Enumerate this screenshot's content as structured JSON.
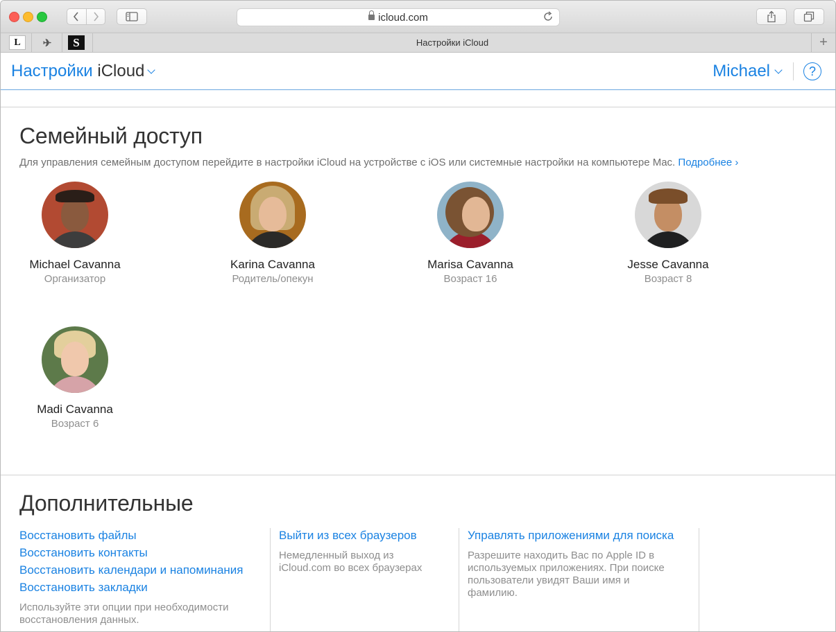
{
  "browser": {
    "url": "icloud.com",
    "tab_title": "Настройки iCloud",
    "favorites": [
      "L",
      "✈",
      "S"
    ]
  },
  "header": {
    "title_prefix": "Настройки",
    "title_app": "iCloud",
    "user": "Michael",
    "help": "?"
  },
  "family": {
    "title": "Семейный доступ",
    "subtitle": "Для управления семейным доступом перейдите в настройки iCloud на устройстве с iOS или системные настройки на компьютере Mac.",
    "more_link": "Подробнее",
    "members": [
      {
        "name": "Michael Cavanna",
        "role": "Организатор"
      },
      {
        "name": "Karina Cavanna",
        "role": "Родитель/опекун"
      },
      {
        "name": "Marisa Cavanna",
        "role": "Возраст 16"
      },
      {
        "name": "Jesse Cavanna",
        "role": "Возраст 8"
      },
      {
        "name": "Madi Cavanna",
        "role": "Возраст 6"
      }
    ]
  },
  "advanced": {
    "title": "Дополнительные",
    "restore_links": [
      "Восстановить файлы",
      "Восстановить контакты",
      "Восстановить календари и напоминания",
      "Восстановить закладки"
    ],
    "restore_desc": "Используйте эти опции при необходимости восстановления данных.",
    "signout_link": "Выйти из всех браузеров",
    "signout_desc": "Немедленный выход из iCloud.com во всех браузерах",
    "apps_link": "Управлять приложениями для поиска",
    "apps_desc": "Разрешите находить Вас по Apple ID в используемых приложениях. При поиске пользователи увидят Ваши имя и фамилию."
  }
}
